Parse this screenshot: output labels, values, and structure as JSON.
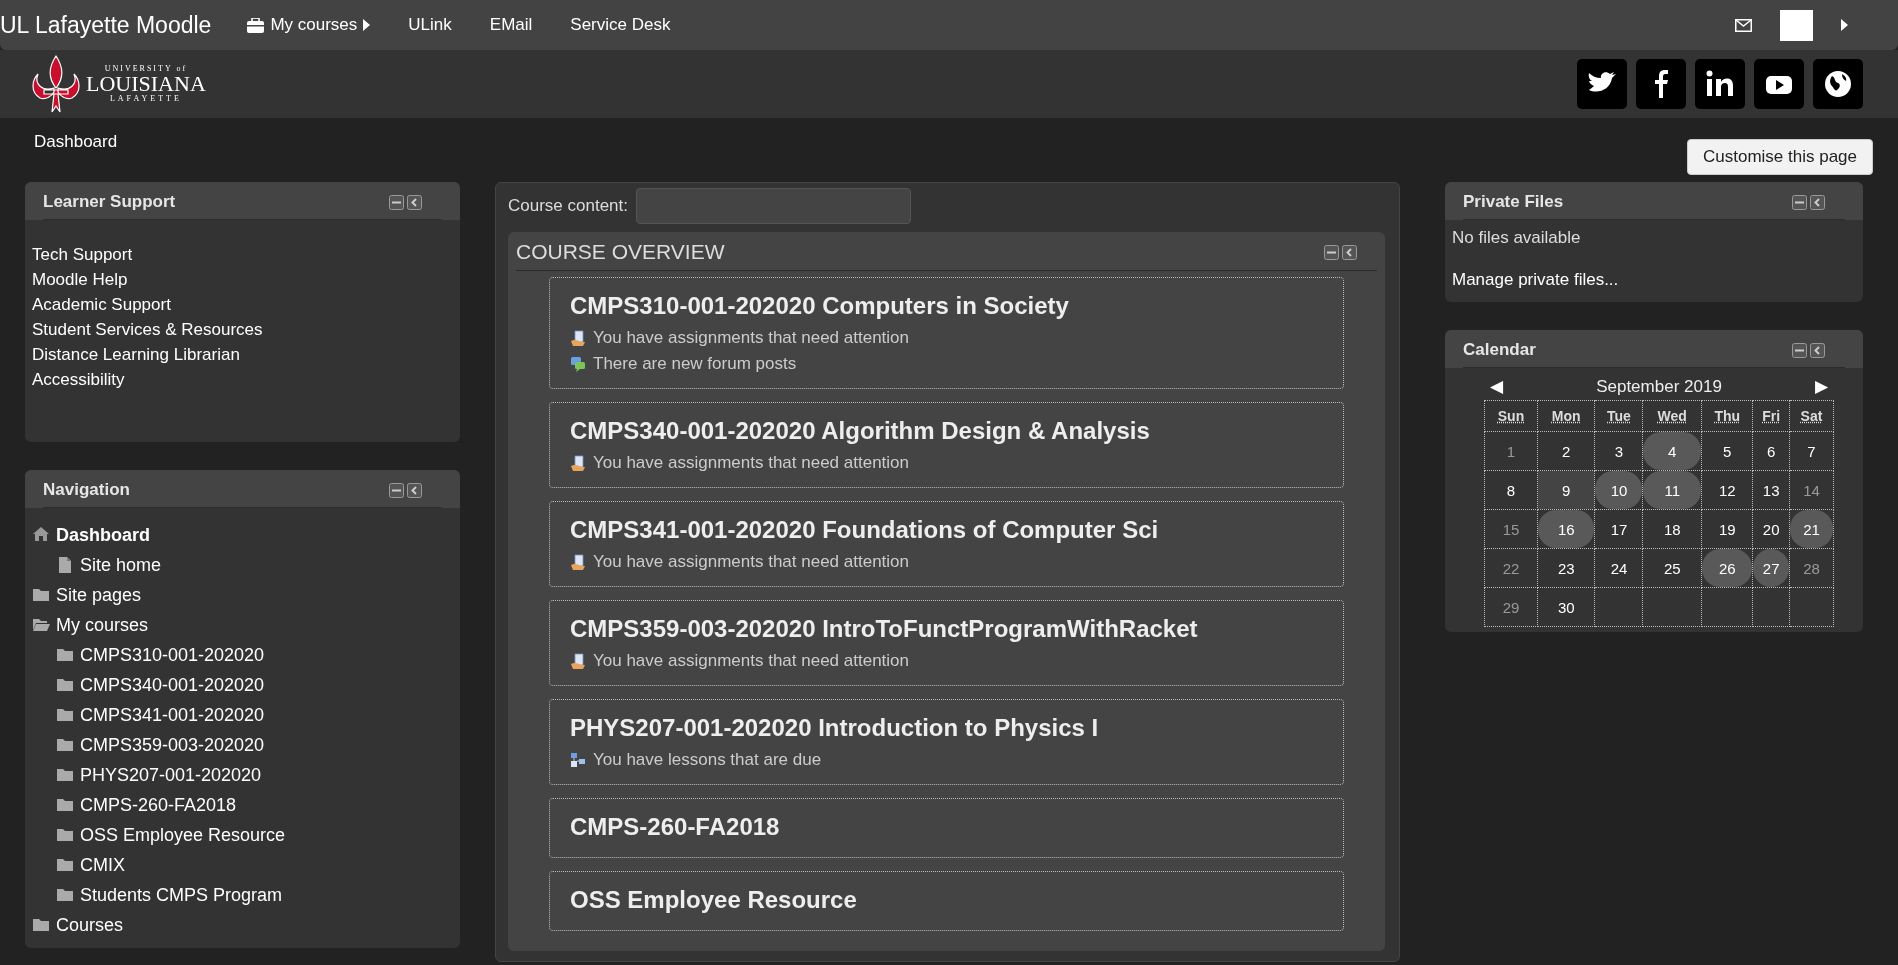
{
  "topbar": {
    "site_title": "UL Lafayette Moodle",
    "menu": [
      {
        "label": "My courses",
        "kind": "dropdown"
      },
      {
        "label": "ULink",
        "kind": "link"
      },
      {
        "label": "EMail",
        "kind": "link"
      },
      {
        "label": "Service Desk",
        "kind": "link"
      }
    ]
  },
  "logo": {
    "line1": "UNIVERSITY of",
    "line2": "LOUISIANA",
    "line3": "LAFAYETTE"
  },
  "breadcrumb": [
    "Dashboard"
  ],
  "customise_button": "Customise this page",
  "learner_support": {
    "title": "Learner Support",
    "links": [
      "Tech Support",
      "Moodle Help",
      "Academic Support",
      "Student Services & Resources",
      "Distance Learning Librarian",
      "Accessibility"
    ]
  },
  "navigation": {
    "title": "Navigation",
    "tree": [
      {
        "label": "Dashboard",
        "kind": "home",
        "current": true,
        "children": [
          {
            "label": "Site home",
            "kind": "page",
            "current": false
          }
        ]
      },
      {
        "label": "Site pages",
        "kind": "folder",
        "current": false
      },
      {
        "label": "My courses",
        "kind": "open",
        "current": false,
        "children": [
          {
            "label": "CMPS310-001-202020",
            "kind": "folder",
            "current": false
          },
          {
            "label": "CMPS340-001-202020",
            "kind": "folder",
            "current": false
          },
          {
            "label": "CMPS341-001-202020",
            "kind": "folder",
            "current": false
          },
          {
            "label": "CMPS359-003-202020",
            "kind": "folder",
            "current": false
          },
          {
            "label": "PHYS207-001-202020",
            "kind": "folder",
            "current": false
          },
          {
            "label": "CMPS-260-FA2018",
            "kind": "folder",
            "current": false
          },
          {
            "label": "OSS Employee Resource",
            "kind": "folder",
            "current": false
          },
          {
            "label": "CMIX",
            "kind": "folder",
            "current": false
          },
          {
            "label": "Students CMPS Program",
            "kind": "folder",
            "current": false
          }
        ]
      },
      {
        "label": "Courses",
        "kind": "folder",
        "current": false
      }
    ]
  },
  "course_content": {
    "label": "Course content:"
  },
  "course_overview": {
    "title": "COURSE OVERVIEW",
    "courses": [
      {
        "title": "CMPS310-001-202020 Computers in Society",
        "notices": [
          {
            "kind": "assignment",
            "text": "You have assignments that need attention"
          },
          {
            "kind": "forum",
            "text": "There are new forum posts"
          }
        ]
      },
      {
        "title": "CMPS340-001-202020 Algorithm Design & Analysis",
        "notices": [
          {
            "kind": "assignment",
            "text": "You have assignments that need attention"
          }
        ]
      },
      {
        "title": "CMPS341-001-202020 Foundations of Computer Sci",
        "notices": [
          {
            "kind": "assignment",
            "text": "You have assignments that need attention"
          }
        ]
      },
      {
        "title": "CMPS359-003-202020 IntroToFunctProgramWithRacket",
        "notices": [
          {
            "kind": "assignment",
            "text": "You have assignments that need attention"
          }
        ]
      },
      {
        "title": "PHYS207-001-202020 Introduction to Physics I",
        "notices": [
          {
            "kind": "lesson",
            "text": "You have lessons that are due"
          }
        ]
      },
      {
        "title": "CMPS-260-FA2018"
      },
      {
        "title": "OSS Employee Resource"
      }
    ]
  },
  "private_files": {
    "title": "Private Files",
    "message": "No files available",
    "link": "Manage private files..."
  },
  "calendar": {
    "title": "Calendar",
    "month": "September 2019",
    "prev": "◀",
    "next": "▶",
    "weekdays": [
      "Sun",
      "Mon",
      "Tue",
      "Wed",
      "Thu",
      "Fri",
      "Sat"
    ],
    "weeks": [
      [
        {
          "day": "1",
          "event": false,
          "today": false,
          "dim": true
        },
        {
          "day": "2",
          "event": false,
          "today": false,
          "dim": false
        },
        {
          "day": "3",
          "event": false,
          "today": false,
          "dim": false
        },
        {
          "day": "4",
          "event": true,
          "today": false,
          "dim": false
        },
        {
          "day": "5",
          "event": false,
          "today": false,
          "dim": false
        },
        {
          "day": "6",
          "event": false,
          "today": false,
          "dim": false
        },
        {
          "day": "7",
          "event": false,
          "today": false,
          "dim": false
        }
      ],
      [
        {
          "day": "8",
          "event": false,
          "today": false,
          "dim": false
        },
        {
          "day": "9",
          "event": false,
          "today": true,
          "dim": false
        },
        {
          "day": "10",
          "event": true,
          "today": false,
          "dim": false
        },
        {
          "day": "11",
          "event": true,
          "today": false,
          "dim": false
        },
        {
          "day": "12",
          "event": false,
          "today": false,
          "dim": false
        },
        {
          "day": "13",
          "event": false,
          "today": false,
          "dim": false
        },
        {
          "day": "14",
          "event": false,
          "today": false,
          "dim": true
        }
      ],
      [
        {
          "day": "15",
          "event": false,
          "today": false,
          "dim": true
        },
        {
          "day": "16",
          "event": true,
          "today": false,
          "dim": false
        },
        {
          "day": "17",
          "event": false,
          "today": false,
          "dim": false
        },
        {
          "day": "18",
          "event": false,
          "today": false,
          "dim": false
        },
        {
          "day": "19",
          "event": false,
          "today": false,
          "dim": false
        },
        {
          "day": "20",
          "event": false,
          "today": false,
          "dim": false
        },
        {
          "day": "21",
          "event": true,
          "today": false,
          "dim": false
        }
      ],
      [
        {
          "day": "22",
          "event": false,
          "today": false,
          "dim": true
        },
        {
          "day": "23",
          "event": false,
          "today": false,
          "dim": false
        },
        {
          "day": "24",
          "event": false,
          "today": false,
          "dim": false
        },
        {
          "day": "25",
          "event": false,
          "today": false,
          "dim": false
        },
        {
          "day": "26",
          "event": true,
          "today": false,
          "dim": false
        },
        {
          "day": "27",
          "event": true,
          "today": false,
          "dim": false
        },
        {
          "day": "28",
          "event": false,
          "today": false,
          "dim": true
        }
      ],
      [
        {
          "day": "29",
          "event": false,
          "today": false,
          "dim": true
        },
        {
          "day": "30",
          "event": false,
          "today": false,
          "dim": false
        }
      ]
    ]
  }
}
